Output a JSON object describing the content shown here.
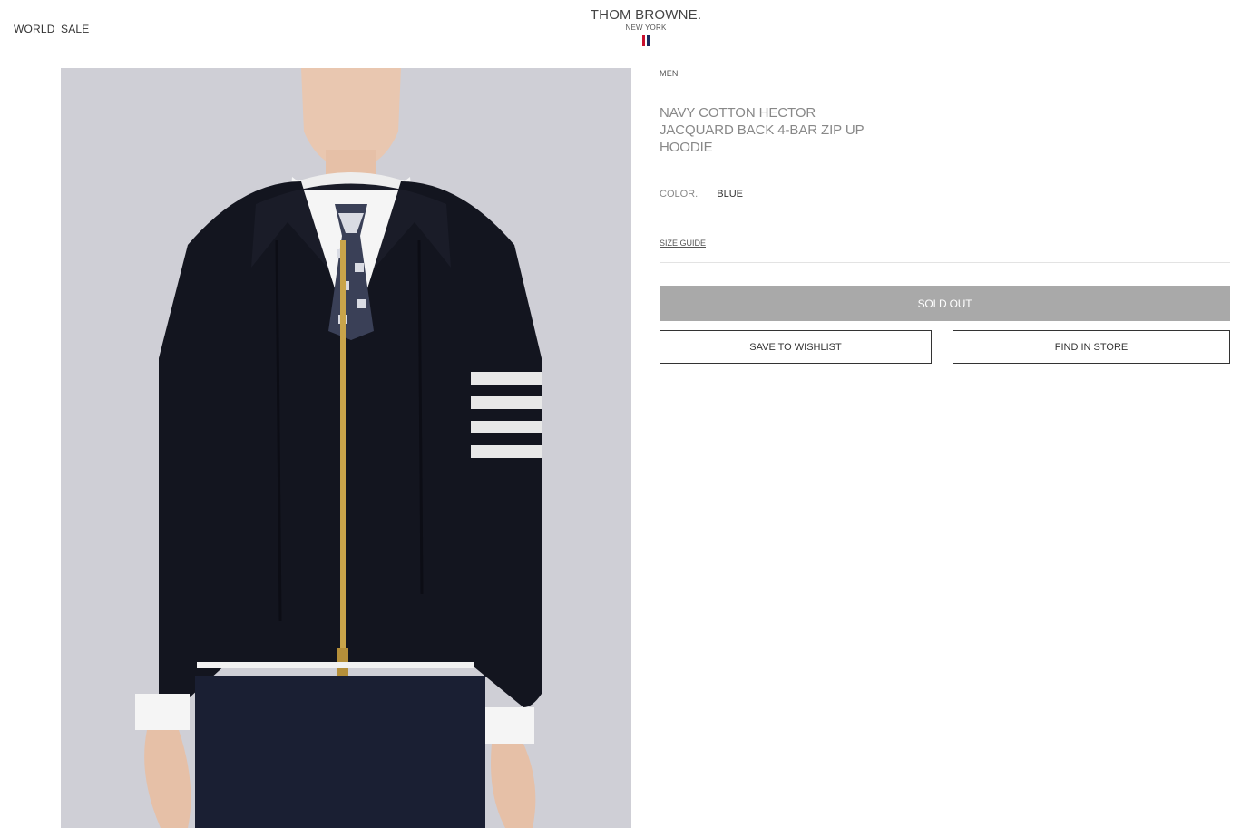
{
  "header": {
    "nav_world": "WORLD",
    "nav_sale": "SALE",
    "logo_main": "THOM BROWNE.",
    "logo_sub": "NEW YORK"
  },
  "product": {
    "category": "MEN",
    "title_lines": [
      "NAVY COTTON HECTOR",
      "JACQUARD BACK 4-BAR ZIP UP",
      "HOODIE"
    ],
    "color_label": "COLOR.",
    "color_value": "BLUE",
    "size_guide": "SIZE GUIDE",
    "sold_out": "SOLD OUT",
    "save_to_wishlist": "SAVE TO WISHLIST",
    "find_in_store": "FIND IN STORE"
  },
  "colors": {
    "image_bg": "#cfcfd6",
    "navy_garment": "#13151f",
    "button_disabled": "#a9a9a9",
    "flag_red": "#c8102e",
    "flag_navy": "#1b2a5e"
  }
}
